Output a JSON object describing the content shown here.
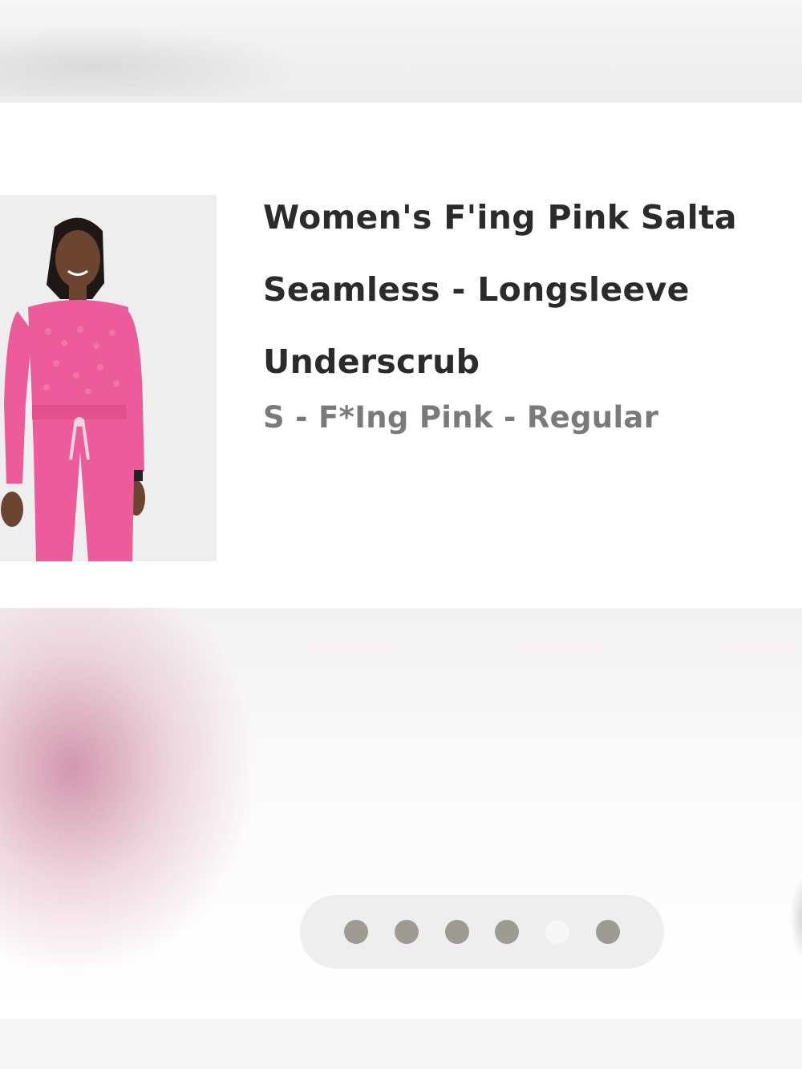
{
  "product": {
    "title_lines": [
      "Women's F'ing Pink Salta",
      "Seamless - Longsleeve",
      "Underscrub"
    ],
    "variant": "S - F*Ing Pink - Regular",
    "image_alt_icon": "product-photo"
  },
  "pager": {
    "dot_count": 6,
    "active_index": 4
  },
  "colors": {
    "title": "#2b2b2b",
    "variant": "#7a7a7a",
    "dot": "#9e9b93",
    "dot_active": "#f7f7f7",
    "accent_pink": "#ec5c9a"
  }
}
